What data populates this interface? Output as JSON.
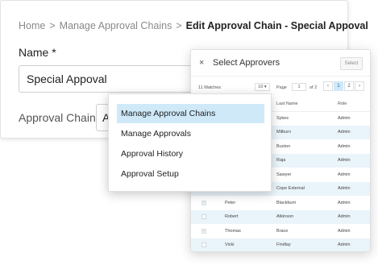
{
  "breadcrumb": {
    "home": "Home",
    "sep": ">",
    "manage": "Manage Approval Chains",
    "current": "Edit Approval Chain - Special Appoval"
  },
  "form": {
    "name_label": "Name *",
    "name_value": "Special Appoval",
    "chain_label": "Approval Chain",
    "chain_value": "A"
  },
  "menu": {
    "items": [
      "Manage Approval Chains",
      "Manage Approvals",
      "Approval History",
      "Approval Setup"
    ],
    "active_index": 0
  },
  "modal": {
    "close_icon": "×",
    "title": "Select Approvers",
    "select_label": "Select",
    "matches": "11 Matches",
    "per_page": "10 ▾",
    "page_label": "Page",
    "page_value": "1",
    "of_label": "of 2",
    "pager": [
      "‹",
      "1",
      "2",
      "›"
    ],
    "columns": [
      "",
      "Last Name",
      "Role"
    ],
    "rows": [
      {
        "first": "",
        "last": "Sykes",
        "role": "Admin",
        "checked": false
      },
      {
        "first": "",
        "last": "Milburn",
        "role": "Admin",
        "checked": false
      },
      {
        "first": "",
        "last": "Buxton",
        "role": "Admin",
        "checked": false
      },
      {
        "first": "",
        "last": "Raja",
        "role": "Admin",
        "checked": false
      },
      {
        "first": "",
        "last": "Sawyer",
        "role": "Admin",
        "checked": false
      },
      {
        "first": "",
        "last": "Cope External",
        "role": "Admin",
        "checked": false
      },
      {
        "first": "Peter",
        "last": "Blackburn",
        "role": "Admin",
        "checked": true
      },
      {
        "first": "Robert",
        "last": "Atkinson",
        "role": "Admin",
        "checked": false
      },
      {
        "first": "Thomas",
        "last": "Brace",
        "role": "Admin",
        "checked": true
      },
      {
        "first": "Vicki",
        "last": "Findlay",
        "role": "Admin",
        "checked": false
      }
    ]
  },
  "colors": {
    "highlight": "#cfe9f9",
    "row_shade": "#eaf4fb"
  }
}
